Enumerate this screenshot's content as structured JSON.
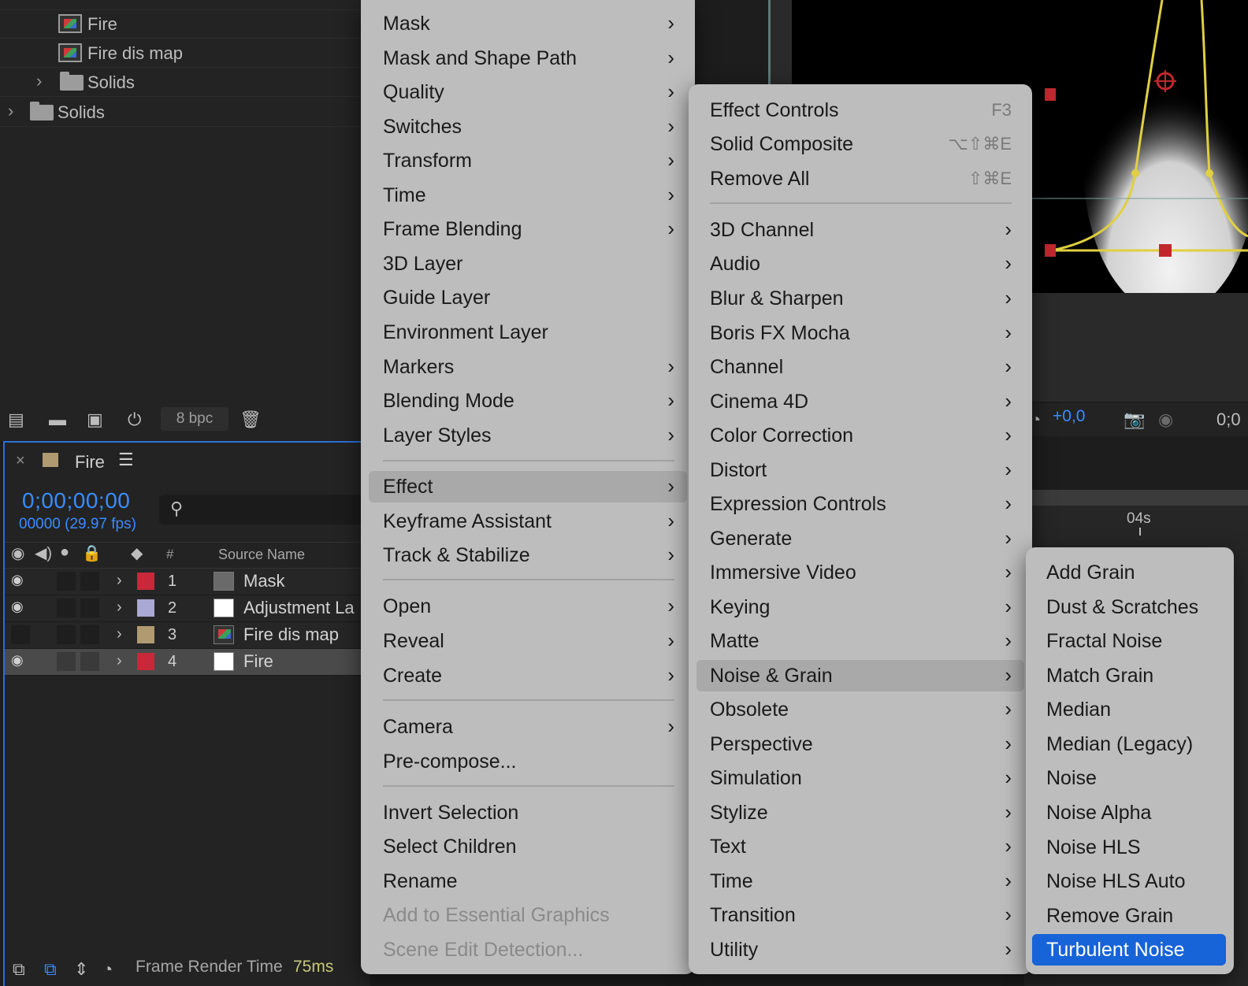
{
  "project_panel": {
    "items": [
      {
        "name": "Fire",
        "type": "footage"
      },
      {
        "name": "Fire dis map",
        "type": "footage"
      },
      {
        "name": "Solids",
        "type": "folder"
      },
      {
        "name": "Solids",
        "type": "folder"
      }
    ],
    "bit_depth": "8 bpc"
  },
  "timeline": {
    "tab_title": "Fire",
    "timecode": "0;00;00;00",
    "frame_info": "00000 (29.97 fps)",
    "columns": {
      "number": "#",
      "source_name": "Source Name"
    },
    "layers": [
      {
        "number": "1",
        "name": "Mask",
        "label_color": "#c8283a",
        "visible": true,
        "selected": false
      },
      {
        "number": "2",
        "name": "Adjustment La",
        "label_color": "#a9a9d4",
        "visible": true,
        "selected": false
      },
      {
        "number": "3",
        "name": "Fire dis map",
        "label_color": "#b09a72",
        "visible": false,
        "selected": false
      },
      {
        "number": "4",
        "name": "Fire",
        "label_color": "#c8283a",
        "visible": true,
        "selected": true
      }
    ],
    "frame_render_label": "Frame Render Time",
    "frame_render_value": "75ms",
    "ruler_label": "04s"
  },
  "viewer": {
    "exposure": "+0,0",
    "timecode_partial": "0;0"
  },
  "context_menu": {
    "items": [
      {
        "label": "Mask",
        "submenu": true
      },
      {
        "label": "Mask and Shape Path",
        "submenu": true
      },
      {
        "label": "Quality",
        "submenu": true
      },
      {
        "label": "Switches",
        "submenu": true
      },
      {
        "label": "Transform",
        "submenu": true
      },
      {
        "label": "Time",
        "submenu": true
      },
      {
        "label": "Frame Blending",
        "submenu": true
      },
      {
        "label": "3D Layer",
        "submenu": false
      },
      {
        "label": "Guide Layer",
        "submenu": false
      },
      {
        "label": "Environment Layer",
        "submenu": false
      },
      {
        "label": "Markers",
        "submenu": true
      },
      {
        "label": "Blending Mode",
        "submenu": true
      },
      {
        "label": "Layer Styles",
        "submenu": true
      },
      {
        "label": "Effect",
        "submenu": true,
        "highlighted": true
      },
      {
        "label": "Keyframe Assistant",
        "submenu": true
      },
      {
        "label": "Track & Stabilize",
        "submenu": true
      },
      {
        "label": "Open",
        "submenu": true
      },
      {
        "label": "Reveal",
        "submenu": true
      },
      {
        "label": "Create",
        "submenu": true
      },
      {
        "label": "Camera",
        "submenu": true
      },
      {
        "label": "Pre-compose...",
        "submenu": false
      },
      {
        "label": "Invert Selection",
        "submenu": false
      },
      {
        "label": "Select Children",
        "submenu": false
      },
      {
        "label": "Rename",
        "submenu": false
      },
      {
        "label": "Add to Essential Graphics",
        "submenu": false,
        "disabled": true
      },
      {
        "label": "Scene Edit Detection...",
        "submenu": false,
        "disabled": true
      }
    ]
  },
  "effect_menu": {
    "items": [
      {
        "label": "Effect Controls",
        "shortcut": "F3"
      },
      {
        "label": "Solid Composite",
        "shortcut": "⌥⇧⌘E"
      },
      {
        "label": "Remove All",
        "shortcut": "⇧⌘E"
      },
      {
        "label": "3D Channel",
        "submenu": true
      },
      {
        "label": "Audio",
        "submenu": true
      },
      {
        "label": "Blur & Sharpen",
        "submenu": true
      },
      {
        "label": "Boris FX Mocha",
        "submenu": true
      },
      {
        "label": "Channel",
        "submenu": true
      },
      {
        "label": "Cinema 4D",
        "submenu": true
      },
      {
        "label": "Color Correction",
        "submenu": true
      },
      {
        "label": "Distort",
        "submenu": true
      },
      {
        "label": "Expression Controls",
        "submenu": true
      },
      {
        "label": "Generate",
        "submenu": true
      },
      {
        "label": "Immersive Video",
        "submenu": true
      },
      {
        "label": "Keying",
        "submenu": true
      },
      {
        "label": "Matte",
        "submenu": true
      },
      {
        "label": "Noise & Grain",
        "submenu": true,
        "highlighted": true
      },
      {
        "label": "Obsolete",
        "submenu": true
      },
      {
        "label": "Perspective",
        "submenu": true
      },
      {
        "label": "Simulation",
        "submenu": true
      },
      {
        "label": "Stylize",
        "submenu": true
      },
      {
        "label": "Text",
        "submenu": true
      },
      {
        "label": "Time",
        "submenu": true
      },
      {
        "label": "Transition",
        "submenu": true
      },
      {
        "label": "Utility",
        "submenu": true
      }
    ]
  },
  "noise_menu": {
    "items": [
      {
        "label": "Add Grain"
      },
      {
        "label": "Dust & Scratches"
      },
      {
        "label": "Fractal Noise"
      },
      {
        "label": "Match Grain"
      },
      {
        "label": "Median"
      },
      {
        "label": "Median (Legacy)"
      },
      {
        "label": "Noise"
      },
      {
        "label": "Noise Alpha"
      },
      {
        "label": "Noise HLS"
      },
      {
        "label": "Noise HLS Auto"
      },
      {
        "label": "Remove Grain"
      },
      {
        "label": "Turbulent Noise",
        "selected": true
      }
    ]
  },
  "colors": {
    "accent_blue": "#1763d8",
    "timecode_blue": "#3a8cff",
    "mask_yellow": "#e0d040",
    "handle_red": "#c0282e"
  }
}
